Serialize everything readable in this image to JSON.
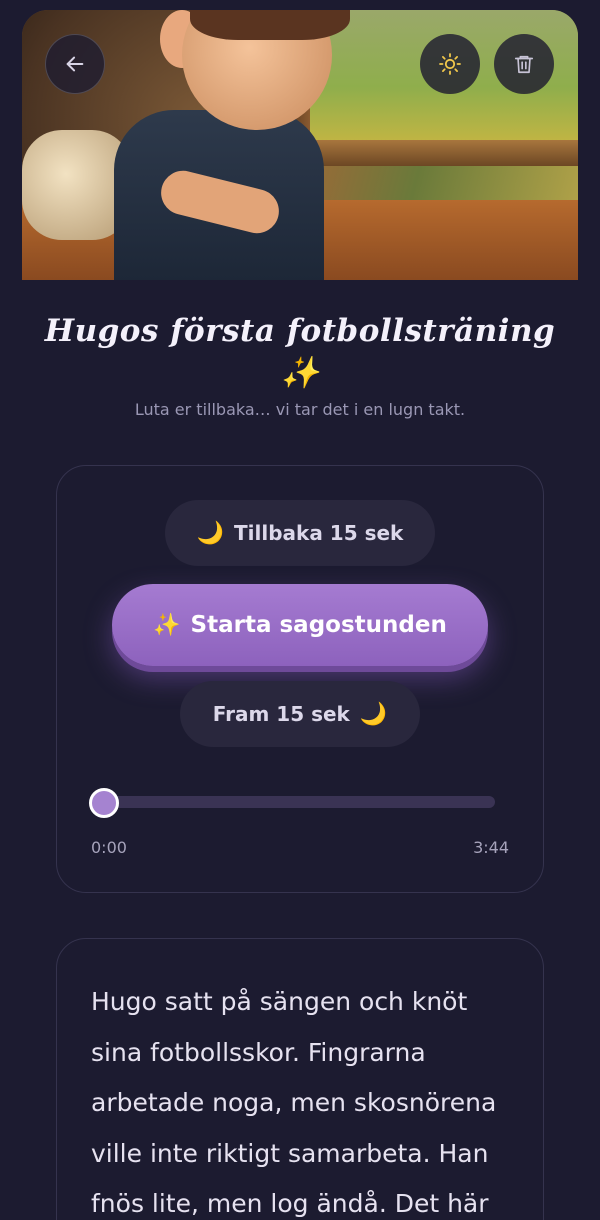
{
  "header": {
    "back_icon": "arrow-left-icon",
    "theme_icon": "sun-icon",
    "delete_icon": "trash-icon"
  },
  "story": {
    "title": "Hugos första fotbollsträning ✨",
    "subtitle": "Luta er tillbaka… vi tar det i en lugn takt.",
    "text": "Hugo satt på sängen och knöt sina fotbollsskor. Fingrarna arbetade noga, men skosnörena ville inte riktigt samarbeta. Han fnös lite, men log ändå. Det här"
  },
  "player": {
    "back_label": "Tillbaka 15 sek",
    "back_emoji": "🌙",
    "play_label": "Starta sagostunden",
    "play_emoji": "✨",
    "forward_label": "Fram 15 sek",
    "forward_emoji": "🌙",
    "current_time": "0:00",
    "total_time": "3:44",
    "progress": 0
  },
  "colors": {
    "background": "#1c1b30",
    "accent": "#9b72c8",
    "sun": "#f2c84b"
  }
}
